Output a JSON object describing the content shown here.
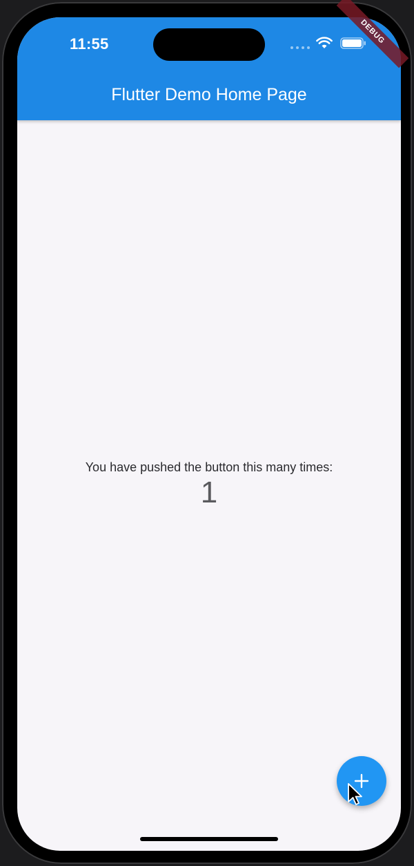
{
  "status_bar": {
    "time": "11:55"
  },
  "debug_banner": {
    "label": "DEBUG"
  },
  "app_bar": {
    "title": "Flutter Demo Home Page"
  },
  "counter": {
    "caption": "You have pushed the button this many times:",
    "value": "1"
  },
  "fab": {
    "icon": "add-icon"
  },
  "colors": {
    "app_bar": "#1e88e5",
    "fab": "#2196f3",
    "background": "#f7f5f9",
    "debug_banner": "#781a26"
  }
}
